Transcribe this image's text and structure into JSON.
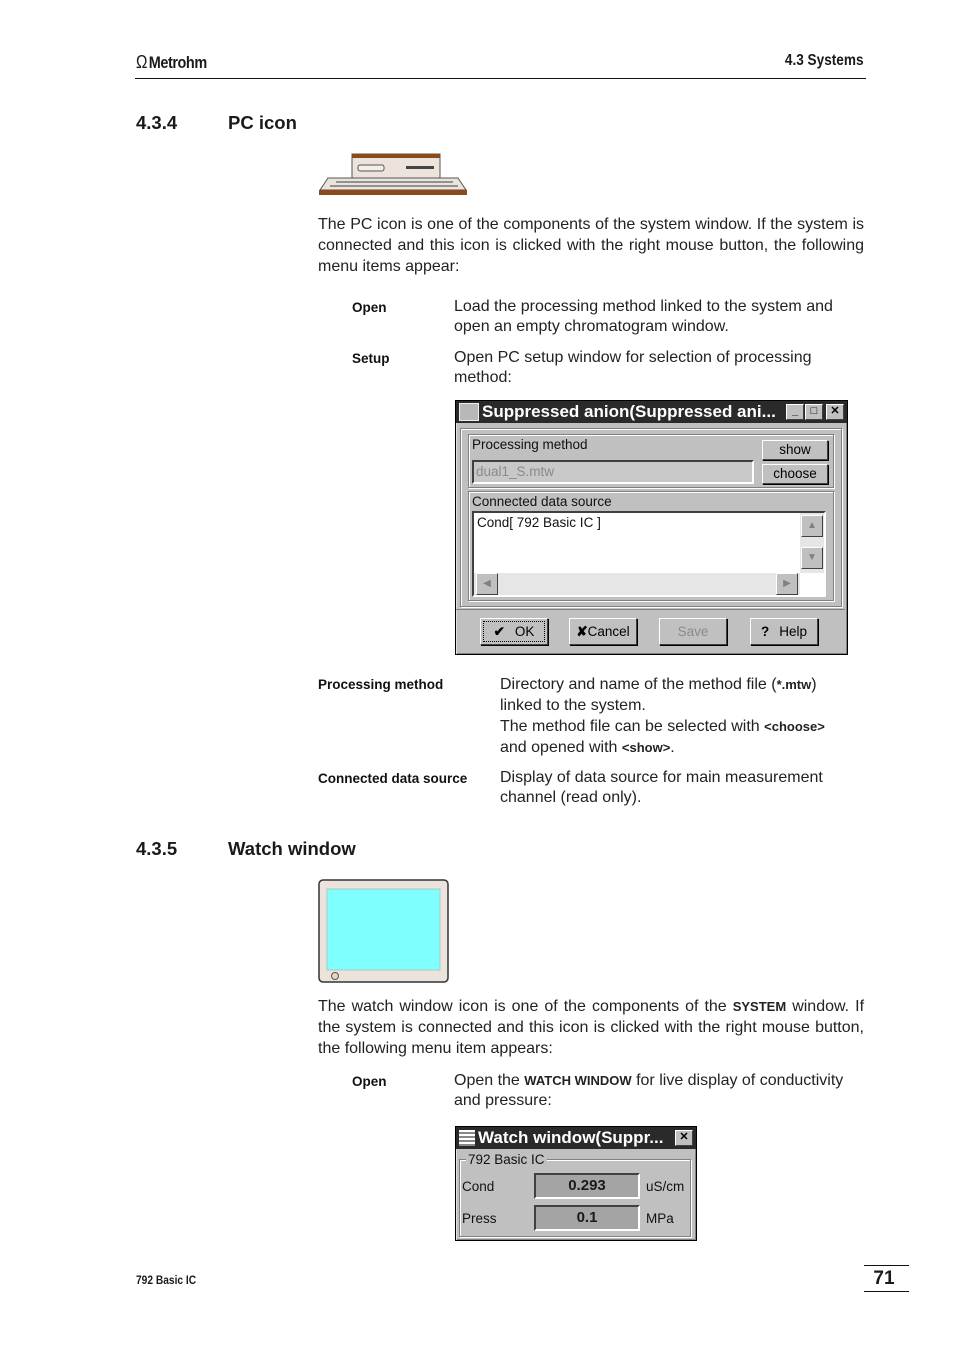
{
  "header": {
    "logo_text": "Metrohm",
    "logo_icon": "omega-logo-icon",
    "section": "4.3  Systems"
  },
  "sections": [
    {
      "number": "4.3.4",
      "title": "PC icon",
      "icon": "pc-icon",
      "intro": "The PC icon is one of the components of the system window. If the system is connected and this icon is clicked with the right mouse button, the following menu items appear:",
      "menu_items": [
        {
          "term": "Open",
          "desc": "Load the processing method linked to the system and open an empty chromatogram window."
        },
        {
          "term": "Setup",
          "desc": "Open PC setup window for selection of processing method:"
        }
      ],
      "dialog": {
        "title": "Suppressed anion(Suppressed ani...",
        "title_icon": "window-app-icon",
        "processing_method_label": "Processing method",
        "processing_method_value": "dual1_S.mtw",
        "show_button": "show",
        "choose_button": "choose",
        "data_source_label": "Connected  data source",
        "data_source_items": [
          "Cond[ 792 Basic IC ]"
        ],
        "buttons": {
          "ok": "OK",
          "cancel": "Cancel",
          "save": "Save",
          "help": "Help"
        }
      },
      "fields": [
        {
          "term": "Processing method",
          "desc_lines": [
            "Directory and name of the method file (",
            "*.mtw",
            ")",
            "linked to the system.",
            "The method file can be selected with ",
            "<choose>",
            "and opened with ",
            "<show>",
            "."
          ]
        },
        {
          "term": "Connected data source",
          "desc": "Display of data source for main measurement channel (read only)."
        }
      ]
    },
    {
      "number": "4.3.5",
      "title": "Watch window",
      "icon": "monitor-icon",
      "intro_a": "The watch window icon is one of the components of the ",
      "intro_bold": "SYSTEM",
      "intro_b": " window. If the system is connected and this icon is clicked with the right mouse button, the following menu item appears:",
      "menu_items": [
        {
          "term": "Open",
          "desc_a": "Open the ",
          "desc_bold": "WATCH WINDOW",
          "desc_b": " for live display of conductivity and pressure:"
        }
      ],
      "watch": {
        "title": "Watch window(Suppr...",
        "group": "792 Basic IC",
        "rows": [
          {
            "label": "Cond",
            "value": "0.293",
            "unit": "uS/cm"
          },
          {
            "label": "Press",
            "value": "0.1",
            "unit": "MPa"
          }
        ]
      }
    }
  ],
  "footer": {
    "product": "792 Basic IC",
    "page": "71"
  }
}
